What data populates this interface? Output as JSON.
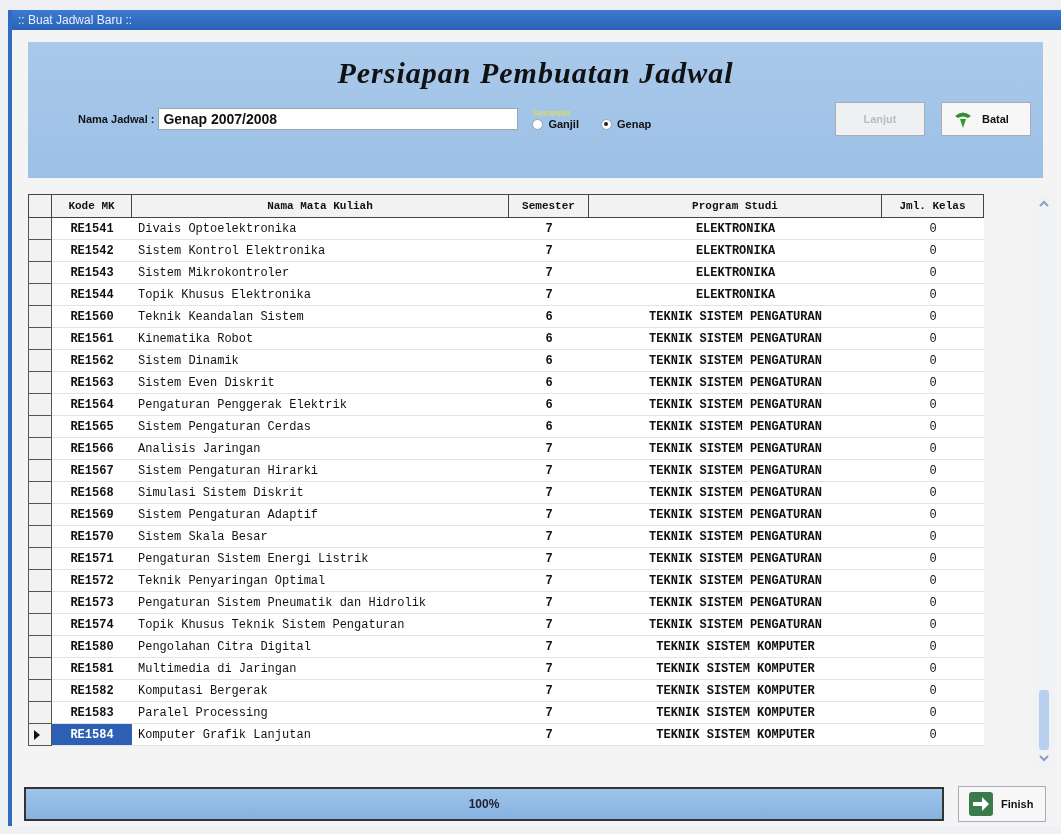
{
  "window": {
    "title": ":: Buat Jadwal Baru ::"
  },
  "header": {
    "title": "Persiapan Pembuatan Jadwal",
    "name_label": "Nama Jadwal :",
    "name_value": "Genap 2007/2008",
    "semester_label": "Semester",
    "semester_options": [
      {
        "label": "Ganjil",
        "selected": false
      },
      {
        "label": "Genap",
        "selected": true
      }
    ],
    "buttons": [
      {
        "label": "Lanjut",
        "kind": "next",
        "disabled": true
      },
      {
        "label": "Batal",
        "kind": "cancel",
        "disabled": false
      }
    ]
  },
  "table": {
    "columns": [
      "Kode MK",
      "Nama Mata Kuliah",
      "Semester",
      "Program Studi",
      "Jml. Kelas"
    ],
    "rows": [
      {
        "code": "RE1541",
        "name": "Divais Optoelektronika",
        "semester": "7",
        "program": "ELEKTRONIKA",
        "classes": "0",
        "selected": false
      },
      {
        "code": "RE1542",
        "name": "Sistem Kontrol Elektronika",
        "semester": "7",
        "program": "ELEKTRONIKA",
        "classes": "0",
        "selected": false
      },
      {
        "code": "RE1543",
        "name": "Sistem Mikrokontroler",
        "semester": "7",
        "program": "ELEKTRONIKA",
        "classes": "0",
        "selected": false
      },
      {
        "code": "RE1544",
        "name": "Topik Khusus Elektronika",
        "semester": "7",
        "program": "ELEKTRONIKA",
        "classes": "0",
        "selected": false
      },
      {
        "code": "RE1560",
        "name": "Teknik Keandalan Sistem",
        "semester": "6",
        "program": "TEKNIK SISTEM PENGATURAN",
        "classes": "0",
        "selected": false
      },
      {
        "code": "RE1561",
        "name": "Kinematika Robot",
        "semester": "6",
        "program": "TEKNIK SISTEM PENGATURAN",
        "classes": "0",
        "selected": false
      },
      {
        "code": "RE1562",
        "name": "Sistem Dinamik",
        "semester": "6",
        "program": "TEKNIK SISTEM PENGATURAN",
        "classes": "0",
        "selected": false
      },
      {
        "code": "RE1563",
        "name": "Sistem Even Diskrit",
        "semester": "6",
        "program": "TEKNIK SISTEM PENGATURAN",
        "classes": "0",
        "selected": false
      },
      {
        "code": "RE1564",
        "name": "Pengaturan Penggerak Elektrik",
        "semester": "6",
        "program": "TEKNIK SISTEM PENGATURAN",
        "classes": "0",
        "selected": false
      },
      {
        "code": "RE1565",
        "name": "Sistem Pengaturan Cerdas",
        "semester": "6",
        "program": "TEKNIK SISTEM PENGATURAN",
        "classes": "0",
        "selected": false
      },
      {
        "code": "RE1566",
        "name": "Analisis Jaringan",
        "semester": "7",
        "program": "TEKNIK SISTEM PENGATURAN",
        "classes": "0",
        "selected": false
      },
      {
        "code": "RE1567",
        "name": "Sistem Pengaturan Hirarki",
        "semester": "7",
        "program": "TEKNIK SISTEM PENGATURAN",
        "classes": "0",
        "selected": false
      },
      {
        "code": "RE1568",
        "name": "Simulasi Sistem Diskrit",
        "semester": "7",
        "program": "TEKNIK SISTEM PENGATURAN",
        "classes": "0",
        "selected": false
      },
      {
        "code": "RE1569",
        "name": "Sistem Pengaturan Adaptif",
        "semester": "7",
        "program": "TEKNIK SISTEM PENGATURAN",
        "classes": "0",
        "selected": false
      },
      {
        "code": "RE1570",
        "name": "Sistem Skala Besar",
        "semester": "7",
        "program": "TEKNIK SISTEM PENGATURAN",
        "classes": "0",
        "selected": false
      },
      {
        "code": "RE1571",
        "name": "Pengaturan Sistem Energi Listrik",
        "semester": "7",
        "program": "TEKNIK SISTEM PENGATURAN",
        "classes": "0",
        "selected": false
      },
      {
        "code": "RE1572",
        "name": "Teknik Penyaringan Optimal",
        "semester": "7",
        "program": "TEKNIK SISTEM PENGATURAN",
        "classes": "0",
        "selected": false
      },
      {
        "code": "RE1573",
        "name": "Pengaturan Sistem Pneumatik dan Hidrolik",
        "semester": "7",
        "program": "TEKNIK SISTEM PENGATURAN",
        "classes": "0",
        "selected": false
      },
      {
        "code": "RE1574",
        "name": "Topik Khusus Teknik Sistem Pengaturan",
        "semester": "7",
        "program": "TEKNIK SISTEM PENGATURAN",
        "classes": "0",
        "selected": false
      },
      {
        "code": "RE1580",
        "name": "Pengolahan Citra Digital",
        "semester": "7",
        "program": "TEKNIK SISTEM KOMPUTER",
        "classes": "0",
        "selected": false
      },
      {
        "code": "RE1581",
        "name": "Multimedia di Jaringan",
        "semester": "7",
        "program": "TEKNIK SISTEM KOMPUTER",
        "classes": "0",
        "selected": false
      },
      {
        "code": "RE1582",
        "name": "Komputasi Bergerak",
        "semester": "7",
        "program": "TEKNIK SISTEM KOMPUTER",
        "classes": "0",
        "selected": false
      },
      {
        "code": "RE1583",
        "name": "Paralel Processing",
        "semester": "7",
        "program": "TEKNIK SISTEM KOMPUTER",
        "classes": "0",
        "selected": false
      },
      {
        "code": "RE1584",
        "name": "Komputer Grafik Lanjutan",
        "semester": "7",
        "program": "TEKNIK SISTEM KOMPUTER",
        "classes": "0",
        "selected": true
      }
    ]
  },
  "progress": {
    "level": 1.0,
    "reading": "100%"
  },
  "finish_button": {
    "label": "Finish"
  }
}
